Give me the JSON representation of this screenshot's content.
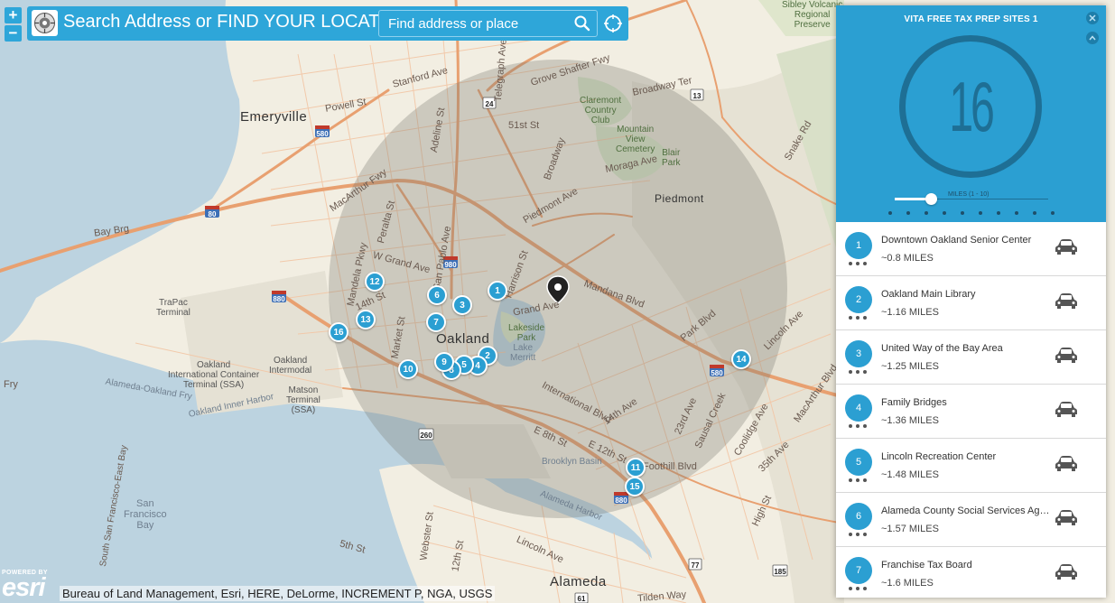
{
  "search": {
    "title": "Search Address or FIND YOUR LOCATION",
    "placeholder": "Find address or place",
    "search_icon": "magnifier-icon",
    "locate_icon": "crosshair-locate-icon"
  },
  "zoom": {
    "in_label": "+",
    "out_label": "−"
  },
  "panel": {
    "title": "VITA FREE TAX PREP SITES 1",
    "count": "16",
    "slider_label": "MILES (1 - 10)",
    "slider_value": 2,
    "slider_min": 1,
    "slider_max": 10,
    "close_icon": "close-icon",
    "collapse_icon": "collapse-up-icon"
  },
  "results": [
    {
      "num": "1",
      "name": "Downtown Oakland Senior Center",
      "distance": "~0.8 MILES"
    },
    {
      "num": "2",
      "name": "Oakland Main Library",
      "distance": "~1.16 MILES"
    },
    {
      "num": "3",
      "name": "United Way of the Bay Area",
      "distance": "~1.25 MILES"
    },
    {
      "num": "4",
      "name": "Family Bridges",
      "distance": "~1.36 MILES"
    },
    {
      "num": "5",
      "name": "Lincoln Recreation Center",
      "distance": "~1.48 MILES"
    },
    {
      "num": "6",
      "name": "Alameda County Social Services Agency",
      "distance": "~1.57 MILES"
    },
    {
      "num": "7",
      "name": "Franchise Tax Board",
      "distance": "~1.6 MILES"
    }
  ],
  "markers": [
    "1",
    "2",
    "3",
    "4",
    "5",
    "6",
    "7",
    "8",
    "9",
    "10",
    "11",
    "12",
    "13",
    "14",
    "15",
    "16"
  ],
  "map_labels": {
    "cities": [
      "Emeryville",
      "Oakland",
      "Piedmont",
      "Alameda"
    ],
    "water": [
      "Oakland\nInternational Container\nTerminal (SSA)",
      "Oakland\nIntermodal",
      "Matson\nTerminal\n(SSA)",
      "TraPac\nTerminal",
      "San\nFrancisco\nBay",
      "Brooklyn Basin",
      "Alameda Harbor",
      "Oakland Inner Harbor",
      "Alameda-Oakland Fry",
      "Lake\nMerritt"
    ],
    "parks": [
      "Claremont\nCountry\nClub",
      "Mountain\nView\nCemetery",
      "Blair\nPark",
      "Lakeside\nPark",
      "Sibley Volcanic\nRegional\nPreserve"
    ],
    "streets": [
      "Bay Brg",
      "Powell St",
      "Stanford Ave",
      "MacArthur Fwy",
      "W Grand Ave",
      "Grand Ave",
      "Piedmont Ave",
      "Moraga Ave",
      "Broadway Ter",
      "Mandana Blvd",
      "Park Blvd",
      "Lincoln Ave",
      "MacArthur Blvd",
      "14th Ave",
      "23rd Ave",
      "Foothill Blvd",
      "E 12th St",
      "E 8th St",
      "International Blvd",
      "Lincoln Ave",
      "Webster St",
      "Market St",
      "Peralta St",
      "Mandela Pkwy",
      "14th St",
      "Adeline St",
      "Telegraph Ave",
      "Broadway",
      "51st St",
      "Grove Shafter Fwy",
      "San Pablo Ave",
      "Harrison St",
      "Central Ave",
      "Tilden Way",
      "Marina Blvd",
      "Sausal Creek",
      "High St",
      "35th Ave",
      "Coolidge Ave",
      "Snake Rd",
      "Fruitvale",
      "South San Francisco-East Bay",
      "Alameda-Oakland Fry",
      "Oakland Inner Harbor",
      "Fry",
      "Marston Way",
      "5th St",
      "12th St",
      "Ashby Ave",
      "Park Blvd"
    ],
    "route_shields": [
      "580",
      "24",
      "980",
      "880",
      "80",
      "260",
      "77",
      "61",
      "185",
      "13",
      "580",
      "880"
    ]
  },
  "attribution": {
    "powered_by": "POWERED BY",
    "logo_word": "esri",
    "text": "Bureau of Land Management, Esri, HERE, DeLorme, INCREMENT P, NGA, USGS"
  },
  "colors": {
    "accent": "#2b9fd2",
    "ring": "#1e6f95",
    "land": "#f2eee2",
    "water": "#bcd3e0",
    "road_major": "#e8a070",
    "road_minor": "#f3c6a5",
    "buffer": "#7b7b73"
  }
}
